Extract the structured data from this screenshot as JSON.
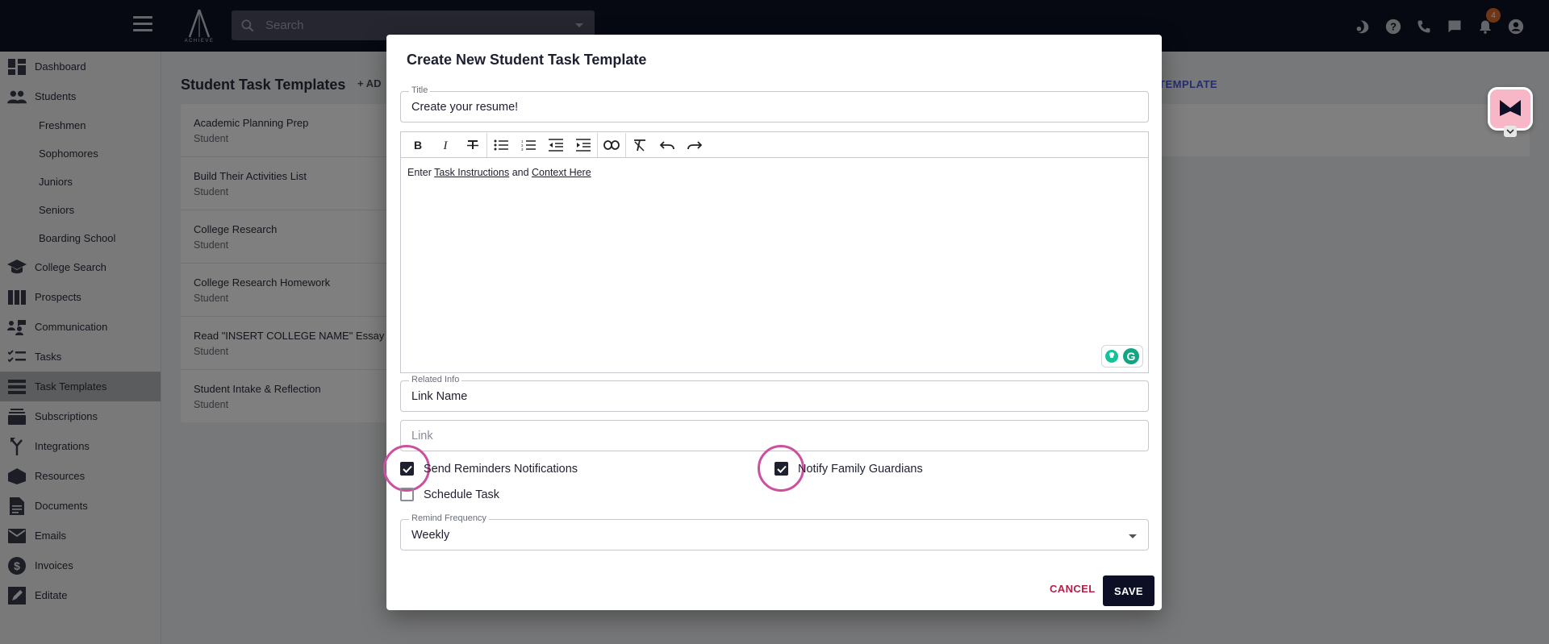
{
  "topbar": {
    "logo_text": "ACHIEVE",
    "search_placeholder": "Search",
    "notification_count": "4",
    "icons": [
      "night-mode-icon",
      "help-icon",
      "phone-icon",
      "chat-icon",
      "bell-icon",
      "account-icon"
    ]
  },
  "sidebar": {
    "items": [
      {
        "label": "Dashboard",
        "icon": "dashboard-icon"
      },
      {
        "label": "Students",
        "icon": "people-icon"
      },
      {
        "label": "Freshmen"
      },
      {
        "label": "Sophomores"
      },
      {
        "label": "Juniors"
      },
      {
        "label": "Seniors"
      },
      {
        "label": "Boarding School"
      },
      {
        "label": "College Search",
        "icon": "school-icon"
      },
      {
        "label": "Prospects",
        "icon": "columns-icon"
      },
      {
        "label": "Communication",
        "icon": "communication-icon"
      },
      {
        "label": "Tasks",
        "icon": "checklist-icon"
      },
      {
        "label": "Task Templates",
        "icon": "list-icon"
      },
      {
        "label": "Subscriptions",
        "icon": "subscriptions-icon"
      },
      {
        "label": "Integrations",
        "icon": "merge-icon"
      },
      {
        "label": "Resources",
        "icon": "box-icon"
      },
      {
        "label": "Documents",
        "icon": "document-icon"
      },
      {
        "label": "Emails",
        "icon": "mail-icon"
      },
      {
        "label": "Invoices",
        "icon": "dollar-icon"
      },
      {
        "label": "Editate",
        "icon": "edit-icon"
      }
    ]
  },
  "main": {
    "title": "Student Task Templates",
    "add_label": "AD",
    "template_label": "TEMPLATE",
    "list": [
      {
        "title": "Academic Planning Prep",
        "sub": "Student"
      },
      {
        "title": "Build Their Activities List",
        "sub": "Student"
      },
      {
        "title": "College Research",
        "sub": "Student"
      },
      {
        "title": "College Research Homework",
        "sub": "Student"
      },
      {
        "title": "Read \"INSERT COLLEGE NAME\" Essay Pro",
        "sub": "Student"
      },
      {
        "title": "Student Intake & Reflection",
        "sub": "Student"
      }
    ]
  },
  "dialog": {
    "title": "Create New Student Task Template",
    "title_field": {
      "label": "Title",
      "value": "Create your resume!"
    },
    "editor": {
      "toolbar": [
        "bold-icon",
        "italic-icon",
        "strikethrough-icon",
        "bullet-list-icon",
        "numbered-list-icon",
        "outdent-icon",
        "indent-icon",
        "link-icon",
        "clear-format-icon",
        "undo-icon",
        "redo-icon"
      ],
      "text_prefix": "Enter ",
      "text_link1": "Task Instructions",
      "text_mid": " and ",
      "text_link2": "Context Here"
    },
    "related_info": {
      "label": "Related Info",
      "value": "Link Name"
    },
    "link_field": {
      "placeholder": "Link"
    },
    "send_reminders": {
      "label": "Send Reminders Notifications",
      "checked": true
    },
    "notify_guardians": {
      "label": "Notify Family Guardians",
      "checked": true
    },
    "schedule_task": {
      "label": "Schedule Task",
      "checked": false
    },
    "remind_frequency": {
      "label": "Remind Frequency",
      "value": "Weekly"
    },
    "cancel_label": "CANCEL",
    "save_label": "SAVE"
  },
  "colors": {
    "topbar": "#0d1024",
    "accent_ring": "#cc4fa0",
    "cancel": "#b51f47",
    "save": "#0d1024"
  }
}
